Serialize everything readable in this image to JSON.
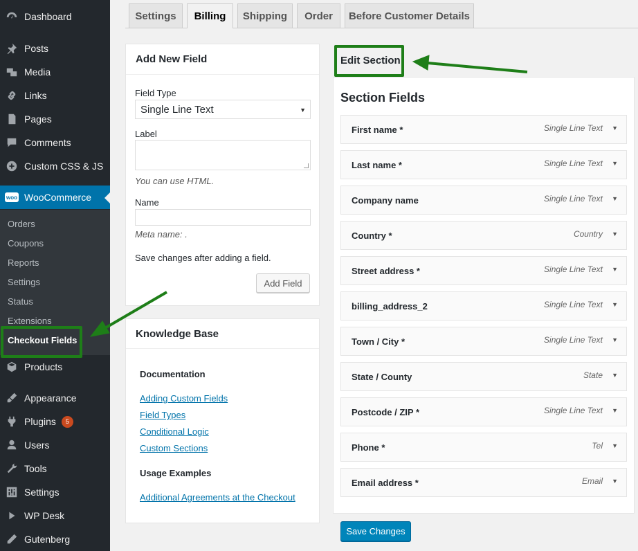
{
  "sidebar": {
    "items": [
      {
        "label": "Dashboard",
        "icon": "dashboard-icon",
        "badge": ""
      },
      {
        "label": "Posts",
        "icon": "pin-icon",
        "badge": ""
      },
      {
        "label": "Media",
        "icon": "media-icon",
        "badge": ""
      },
      {
        "label": "Links",
        "icon": "link-icon",
        "badge": ""
      },
      {
        "label": "Pages",
        "icon": "page-icon",
        "badge": ""
      },
      {
        "label": "Comments",
        "icon": "comment-icon",
        "badge": ""
      },
      {
        "label": "Custom CSS & JS",
        "icon": "plus-circle-icon",
        "badge": ""
      },
      {
        "label": "WooCommerce",
        "icon": "woo-icon",
        "badge": ""
      },
      {
        "label": "Products",
        "icon": "box-icon",
        "badge": ""
      },
      {
        "label": "Appearance",
        "icon": "brush-icon",
        "badge": ""
      },
      {
        "label": "Plugins",
        "icon": "plugin-icon",
        "badge": "5"
      },
      {
        "label": "Users",
        "icon": "user-icon",
        "badge": ""
      },
      {
        "label": "Tools",
        "icon": "wrench-icon",
        "badge": ""
      },
      {
        "label": "Settings",
        "icon": "settings-icon",
        "badge": ""
      },
      {
        "label": "WP Desk",
        "icon": "play-icon",
        "badge": ""
      },
      {
        "label": "Gutenberg",
        "icon": "pen-icon",
        "badge": ""
      }
    ],
    "woo_logo_text": "woo",
    "submenu": [
      "Orders",
      "Coupons",
      "Reports",
      "Settings",
      "Status",
      "Extensions",
      "Checkout Fields"
    ]
  },
  "tabs": [
    "Settings",
    "Billing",
    "Shipping",
    "Order",
    "Before Customer Details"
  ],
  "add_field": {
    "title": "Add New Field",
    "field_type_label": "Field Type",
    "field_type_value": "Single Line Text",
    "label_label": "Label",
    "html_hint": "You can use HTML.",
    "name_label": "Name",
    "meta_hint": "Meta name: .",
    "save_note": "Save changes after adding a field.",
    "add_button": "Add Field"
  },
  "knowledge_base": {
    "title": "Knowledge Base",
    "documentation_heading": "Documentation",
    "doc_links": [
      "Adding Custom Fields",
      "Field Types",
      "Conditional Logic",
      "Custom Sections"
    ],
    "usage_heading": "Usage Examples",
    "usage_links": [
      "Additional Agreements at the Checkout"
    ]
  },
  "edit_section": {
    "title": "Edit Section",
    "section_fields_title": "Section Fields",
    "fields": [
      {
        "name": "First name *",
        "type": "Single Line Text"
      },
      {
        "name": "Last name *",
        "type": "Single Line Text"
      },
      {
        "name": "Company name",
        "type": "Single Line Text"
      },
      {
        "name": "Country *",
        "type": "Country"
      },
      {
        "name": "Street address *",
        "type": "Single Line Text"
      },
      {
        "name": "billing_address_2",
        "type": "Single Line Text"
      },
      {
        "name": "Town / City *",
        "type": "Single Line Text"
      },
      {
        "name": "State / County",
        "type": "State"
      },
      {
        "name": "Postcode / ZIP *",
        "type": "Single Line Text"
      },
      {
        "name": "Phone *",
        "type": "Tel"
      },
      {
        "name": "Email address *",
        "type": "Email"
      }
    ],
    "save_button": "Save Changes"
  },
  "colors": {
    "sidebar_bg": "#23282d",
    "active_blue": "#0073aa",
    "highlight_green": "#1e7e18",
    "primary_button": "#0085ba"
  }
}
